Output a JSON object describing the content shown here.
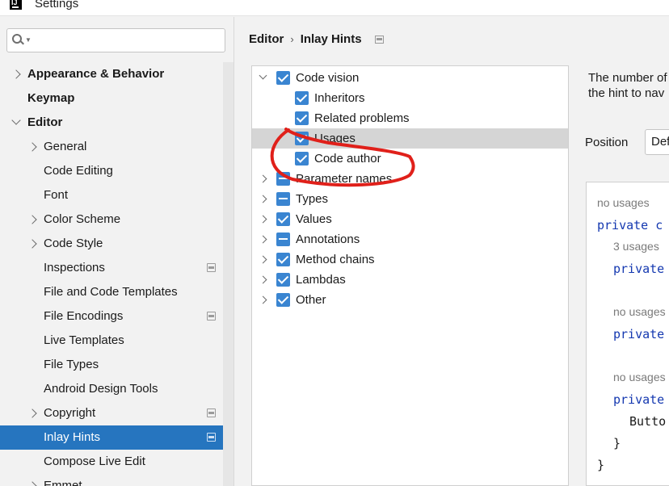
{
  "window": {
    "title": "Settings",
    "app_icon": "intellij-app-icon"
  },
  "search": {
    "placeholder": "",
    "value": ""
  },
  "sidebar": {
    "items": [
      {
        "label": "Appearance & Behavior",
        "indent": 0,
        "bold": true,
        "expander": "collapsed"
      },
      {
        "label": "Keymap",
        "indent": 0,
        "bold": true,
        "expander": "none"
      },
      {
        "label": "Editor",
        "indent": 0,
        "bold": true,
        "expander": "expanded"
      },
      {
        "label": "General",
        "indent": 1,
        "expander": "collapsed"
      },
      {
        "label": "Code Editing",
        "indent": 1,
        "expander": "none"
      },
      {
        "label": "Font",
        "indent": 1,
        "expander": "none"
      },
      {
        "label": "Color Scheme",
        "indent": 1,
        "expander": "collapsed"
      },
      {
        "label": "Code Style",
        "indent": 1,
        "expander": "collapsed"
      },
      {
        "label": "Inspections",
        "indent": 1,
        "expander": "none",
        "project_icon": true
      },
      {
        "label": "File and Code Templates",
        "indent": 1,
        "expander": "none"
      },
      {
        "label": "File Encodings",
        "indent": 1,
        "expander": "none",
        "project_icon": true
      },
      {
        "label": "Live Templates",
        "indent": 1,
        "expander": "none"
      },
      {
        "label": "File Types",
        "indent": 1,
        "expander": "none"
      },
      {
        "label": "Android Design Tools",
        "indent": 1,
        "expander": "none"
      },
      {
        "label": "Copyright",
        "indent": 1,
        "expander": "collapsed",
        "project_icon": true
      },
      {
        "label": "Inlay Hints",
        "indent": 1,
        "expander": "none",
        "project_icon": true,
        "selected": true
      },
      {
        "label": "Compose Live Edit",
        "indent": 1,
        "expander": "none"
      },
      {
        "label": "Emmet",
        "indent": 1,
        "expander": "collapsed"
      }
    ]
  },
  "breadcrumb": {
    "parent": "Editor",
    "separator": "›",
    "current": "Inlay Hints"
  },
  "tree": {
    "rows": [
      {
        "label": "Code vision",
        "level": 0,
        "expander": "expanded",
        "state": "checked"
      },
      {
        "label": "Inheritors",
        "level": 1,
        "expander": "none",
        "state": "checked"
      },
      {
        "label": "Related problems",
        "level": 1,
        "expander": "none",
        "state": "checked"
      },
      {
        "label": "Usages",
        "level": 1,
        "expander": "none",
        "state": "checked",
        "highlighted": true
      },
      {
        "label": "Code author",
        "level": 1,
        "expander": "none",
        "state": "checked"
      },
      {
        "label": "Parameter names",
        "level": 0,
        "expander": "collapsed",
        "state": "partial"
      },
      {
        "label": "Types",
        "level": 0,
        "expander": "collapsed",
        "state": "partial"
      },
      {
        "label": "Values",
        "level": 0,
        "expander": "collapsed",
        "state": "checked"
      },
      {
        "label": "Annotations",
        "level": 0,
        "expander": "collapsed",
        "state": "partial"
      },
      {
        "label": "Method chains",
        "level": 0,
        "expander": "collapsed",
        "state": "checked"
      },
      {
        "label": "Lambdas",
        "level": 0,
        "expander": "collapsed",
        "state": "checked"
      },
      {
        "label": "Other",
        "level": 0,
        "expander": "collapsed",
        "state": "checked"
      }
    ]
  },
  "annotation": {
    "color": "#e0201a"
  },
  "detail": {
    "description_lines": [
      "The number of",
      "the hint to nav"
    ],
    "position_label": "Position",
    "position_value": "Def"
  },
  "preview": {
    "lines": [
      {
        "text": "no usages",
        "kind": "hint",
        "indent": 0
      },
      {
        "text": "private c",
        "kind": "kw",
        "indent": 0
      },
      {
        "text": "3 usages",
        "kind": "hint",
        "indent": 1
      },
      {
        "text": "private",
        "kind": "kw",
        "indent": 1
      },
      {
        "text": "no usages",
        "kind": "hint",
        "indent": 1
      },
      {
        "text": "private",
        "kind": "kw",
        "indent": 1
      },
      {
        "text": "no usages",
        "kind": "hint",
        "indent": 1
      },
      {
        "text": "private",
        "kind": "kw",
        "indent": 1
      },
      {
        "text": "Butto",
        "kind": "plain",
        "indent": 2
      },
      {
        "text": "}",
        "kind": "plain",
        "indent": 1
      },
      {
        "text": "}",
        "kind": "plain",
        "indent": 0
      }
    ]
  }
}
